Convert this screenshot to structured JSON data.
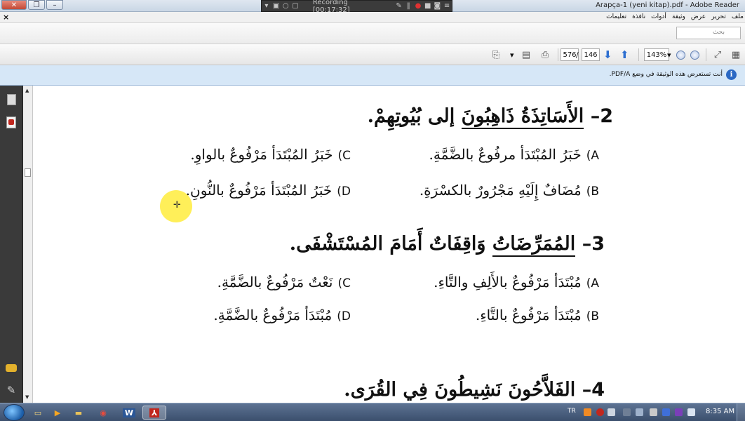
{
  "window": {
    "title": "Arapça-1 (yeni kitap).pdf - Adobe Reader",
    "minimize_glyph": "–",
    "restore_glyph": "❐",
    "close_glyph": "✕"
  },
  "recording": {
    "label": "Recording [00:17:32]"
  },
  "menu": {
    "close_glyph": "×",
    "items": [
      "ملف",
      "تحرير",
      "عرض",
      "وثيقة",
      "أدوات",
      "نافذة",
      "تعليمات"
    ]
  },
  "search": {
    "placeholder": "بحث"
  },
  "toolbar": {
    "current_page": "576",
    "page_separator": "/",
    "total_pages": "146",
    "zoom": "143%",
    "dropdown_glyph": "▾"
  },
  "infobar": {
    "text": "أنت تستعرض هذه الوثيقة في وضع PDF/A.",
    "icon_glyph": "i"
  },
  "document": {
    "questions": [
      {
        "number": "2",
        "dash": "–",
        "text_before": "",
        "underlined": "الأَسَاتِذَةُ ذَاهِبُونَ",
        "text_after": " إلى بُيُوتِهِمْ.",
        "options": {
          "A": "خَبَرُ المُبْتَدَأ مرفُوعٌ بالضَّمَّةِ.",
          "B": "مُضَافٌ إِلَيْهِ مَجْرُورٌ بالكسْرَةِ.",
          "C": "خَبَرُ المُبْتَدَأ مَرْفُوعٌ بالواوِ.",
          "D": "خَبَرُ المُبْتَدَأ مَرْفُوعٌ بالنُّونِ."
        }
      },
      {
        "number": "3",
        "dash": "–",
        "underlined": "المُمَرِّضَاتُ",
        "text_after": " وَاقِفَاتٌ أَمَامَ المُسْتَشْفَى.",
        "options": {
          "A": "مُبْتَدَأ مَرْفُوعٌ بالأَلِفِ والتَّاءِ.",
          "B": "مُبْتَدَأ مَرْفُوعٌ بالتَّاءِ.",
          "C": "نَعْتٌ مَرْفُوعٌ بالضَّمَّةِ.",
          "D": "مُبْتَدَأ مَرْفُوعٌ بالضَّمَّةِ."
        }
      },
      {
        "number": "4",
        "dash": "–",
        "underlined": "",
        "text_after": "الفَلاَّحُونَ نَشِيطُونَ فِي القُرَى."
      }
    ],
    "option_letters": {
      "A": "A)",
      "B": "B)",
      "C": "C)",
      "D": "D)"
    }
  },
  "taskbar": {
    "language": "TR",
    "clock": "8:35 AM",
    "apps": [
      "file-explorer",
      "media-player",
      "folder",
      "chrome",
      "word",
      "adobe-reader"
    ]
  },
  "colors": {
    "accent_blue": "#2e6fd0",
    "infobar_bg": "#d6e7f7",
    "cursor_highlight": "#ffec3c",
    "leftnav_bg": "#3a3a3a"
  }
}
